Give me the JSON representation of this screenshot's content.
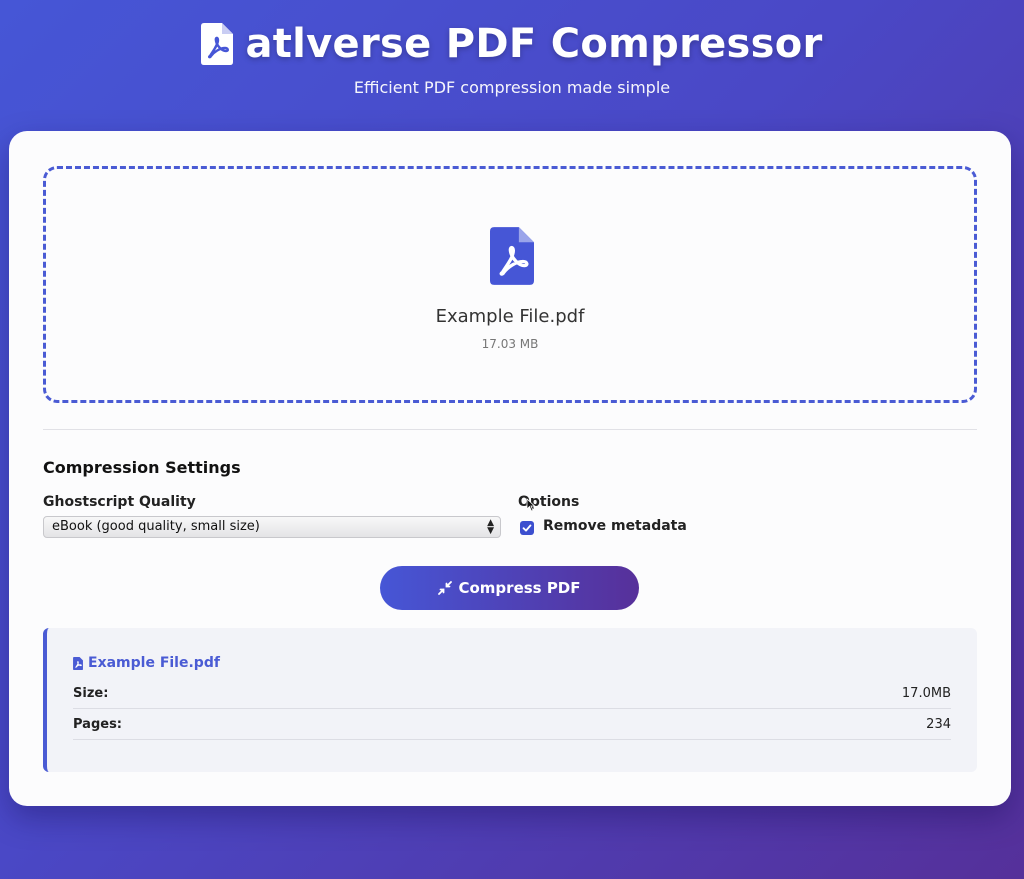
{
  "header": {
    "title": "atlverse PDF Compressor",
    "subtitle": "Efficient PDF compression made simple",
    "icon": "pdf-file-icon"
  },
  "dropzone": {
    "file_name": "Example File.pdf",
    "file_size": "17.03 MB",
    "icon": "pdf-file-icon"
  },
  "settings": {
    "title": "Compression Settings",
    "quality_label": "Ghostscript Quality",
    "quality_selected": "eBook (good quality, small size)",
    "options_label": "Options",
    "remove_metadata_label": "Remove metadata",
    "remove_metadata_checked": true
  },
  "compress_button": {
    "label": "Compress PDF",
    "icon": "compress-icon"
  },
  "file_info": {
    "title": "Example File.pdf",
    "rows": [
      {
        "key": "Size:",
        "value": "17.0MB"
      },
      {
        "key": "Pages:",
        "value": "234"
      }
    ]
  },
  "colors": {
    "accent": "#4a5bd4",
    "gradient_start": "#4656d6",
    "gradient_end": "#57309a"
  }
}
